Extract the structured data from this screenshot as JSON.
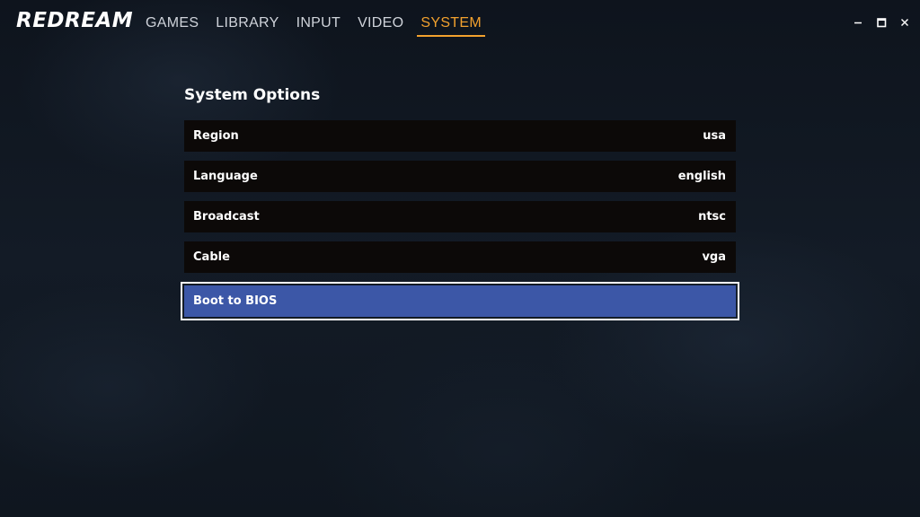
{
  "app": {
    "logo_text": "REDREAM"
  },
  "nav": {
    "tabs": [
      {
        "label": "GAMES"
      },
      {
        "label": "LIBRARY"
      },
      {
        "label": "INPUT"
      },
      {
        "label": "VIDEO"
      },
      {
        "label": "SYSTEM"
      }
    ],
    "active_tab": "SYSTEM",
    "active_color": "#f2a12e"
  },
  "window_controls": {
    "minimize_icon": "minimize-icon",
    "maximize_icon": "maximize-icon",
    "close_icon": "close-icon"
  },
  "system_options": {
    "title": "System Options",
    "rows": [
      {
        "label": "Region",
        "value": "usa"
      },
      {
        "label": "Language",
        "value": "english"
      },
      {
        "label": "Broadcast",
        "value": "ntsc"
      },
      {
        "label": "Cable",
        "value": "vga"
      },
      {
        "label": "Boot to BIOS",
        "value": ""
      }
    ],
    "selected_row": "Boot to BIOS",
    "selected_color": "#3c57a7"
  }
}
